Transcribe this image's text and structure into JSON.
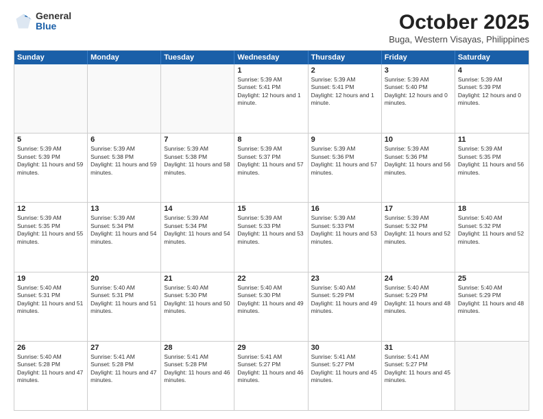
{
  "logo": {
    "general": "General",
    "blue": "Blue"
  },
  "title": "October 2025",
  "location": "Buga, Western Visayas, Philippines",
  "days_of_week": [
    "Sunday",
    "Monday",
    "Tuesday",
    "Wednesday",
    "Thursday",
    "Friday",
    "Saturday"
  ],
  "weeks": [
    [
      {
        "day": "",
        "sunrise": "",
        "sunset": "",
        "daylight": "",
        "empty": true
      },
      {
        "day": "",
        "sunrise": "",
        "sunset": "",
        "daylight": "",
        "empty": true
      },
      {
        "day": "",
        "sunrise": "",
        "sunset": "",
        "daylight": "",
        "empty": true
      },
      {
        "day": "1",
        "sunrise": "Sunrise: 5:39 AM",
        "sunset": "Sunset: 5:41 PM",
        "daylight": "Daylight: 12 hours and 1 minute."
      },
      {
        "day": "2",
        "sunrise": "Sunrise: 5:39 AM",
        "sunset": "Sunset: 5:41 PM",
        "daylight": "Daylight: 12 hours and 1 minute."
      },
      {
        "day": "3",
        "sunrise": "Sunrise: 5:39 AM",
        "sunset": "Sunset: 5:40 PM",
        "daylight": "Daylight: 12 hours and 0 minutes."
      },
      {
        "day": "4",
        "sunrise": "Sunrise: 5:39 AM",
        "sunset": "Sunset: 5:39 PM",
        "daylight": "Daylight: 12 hours and 0 minutes."
      }
    ],
    [
      {
        "day": "5",
        "sunrise": "Sunrise: 5:39 AM",
        "sunset": "Sunset: 5:39 PM",
        "daylight": "Daylight: 11 hours and 59 minutes."
      },
      {
        "day": "6",
        "sunrise": "Sunrise: 5:39 AM",
        "sunset": "Sunset: 5:38 PM",
        "daylight": "Daylight: 11 hours and 59 minutes."
      },
      {
        "day": "7",
        "sunrise": "Sunrise: 5:39 AM",
        "sunset": "Sunset: 5:38 PM",
        "daylight": "Daylight: 11 hours and 58 minutes."
      },
      {
        "day": "8",
        "sunrise": "Sunrise: 5:39 AM",
        "sunset": "Sunset: 5:37 PM",
        "daylight": "Daylight: 11 hours and 57 minutes."
      },
      {
        "day": "9",
        "sunrise": "Sunrise: 5:39 AM",
        "sunset": "Sunset: 5:36 PM",
        "daylight": "Daylight: 11 hours and 57 minutes."
      },
      {
        "day": "10",
        "sunrise": "Sunrise: 5:39 AM",
        "sunset": "Sunset: 5:36 PM",
        "daylight": "Daylight: 11 hours and 56 minutes."
      },
      {
        "day": "11",
        "sunrise": "Sunrise: 5:39 AM",
        "sunset": "Sunset: 5:35 PM",
        "daylight": "Daylight: 11 hours and 56 minutes."
      }
    ],
    [
      {
        "day": "12",
        "sunrise": "Sunrise: 5:39 AM",
        "sunset": "Sunset: 5:35 PM",
        "daylight": "Daylight: 11 hours and 55 minutes."
      },
      {
        "day": "13",
        "sunrise": "Sunrise: 5:39 AM",
        "sunset": "Sunset: 5:34 PM",
        "daylight": "Daylight: 11 hours and 54 minutes."
      },
      {
        "day": "14",
        "sunrise": "Sunrise: 5:39 AM",
        "sunset": "Sunset: 5:34 PM",
        "daylight": "Daylight: 11 hours and 54 minutes."
      },
      {
        "day": "15",
        "sunrise": "Sunrise: 5:39 AM",
        "sunset": "Sunset: 5:33 PM",
        "daylight": "Daylight: 11 hours and 53 minutes."
      },
      {
        "day": "16",
        "sunrise": "Sunrise: 5:39 AM",
        "sunset": "Sunset: 5:33 PM",
        "daylight": "Daylight: 11 hours and 53 minutes."
      },
      {
        "day": "17",
        "sunrise": "Sunrise: 5:39 AM",
        "sunset": "Sunset: 5:32 PM",
        "daylight": "Daylight: 11 hours and 52 minutes."
      },
      {
        "day": "18",
        "sunrise": "Sunrise: 5:40 AM",
        "sunset": "Sunset: 5:32 PM",
        "daylight": "Daylight: 11 hours and 52 minutes."
      }
    ],
    [
      {
        "day": "19",
        "sunrise": "Sunrise: 5:40 AM",
        "sunset": "Sunset: 5:31 PM",
        "daylight": "Daylight: 11 hours and 51 minutes."
      },
      {
        "day": "20",
        "sunrise": "Sunrise: 5:40 AM",
        "sunset": "Sunset: 5:31 PM",
        "daylight": "Daylight: 11 hours and 51 minutes."
      },
      {
        "day": "21",
        "sunrise": "Sunrise: 5:40 AM",
        "sunset": "Sunset: 5:30 PM",
        "daylight": "Daylight: 11 hours and 50 minutes."
      },
      {
        "day": "22",
        "sunrise": "Sunrise: 5:40 AM",
        "sunset": "Sunset: 5:30 PM",
        "daylight": "Daylight: 11 hours and 49 minutes."
      },
      {
        "day": "23",
        "sunrise": "Sunrise: 5:40 AM",
        "sunset": "Sunset: 5:29 PM",
        "daylight": "Daylight: 11 hours and 49 minutes."
      },
      {
        "day": "24",
        "sunrise": "Sunrise: 5:40 AM",
        "sunset": "Sunset: 5:29 PM",
        "daylight": "Daylight: 11 hours and 48 minutes."
      },
      {
        "day": "25",
        "sunrise": "Sunrise: 5:40 AM",
        "sunset": "Sunset: 5:29 PM",
        "daylight": "Daylight: 11 hours and 48 minutes."
      }
    ],
    [
      {
        "day": "26",
        "sunrise": "Sunrise: 5:40 AM",
        "sunset": "Sunset: 5:28 PM",
        "daylight": "Daylight: 11 hours and 47 minutes."
      },
      {
        "day": "27",
        "sunrise": "Sunrise: 5:41 AM",
        "sunset": "Sunset: 5:28 PM",
        "daylight": "Daylight: 11 hours and 47 minutes."
      },
      {
        "day": "28",
        "sunrise": "Sunrise: 5:41 AM",
        "sunset": "Sunset: 5:28 PM",
        "daylight": "Daylight: 11 hours and 46 minutes."
      },
      {
        "day": "29",
        "sunrise": "Sunrise: 5:41 AM",
        "sunset": "Sunset: 5:27 PM",
        "daylight": "Daylight: 11 hours and 46 minutes."
      },
      {
        "day": "30",
        "sunrise": "Sunrise: 5:41 AM",
        "sunset": "Sunset: 5:27 PM",
        "daylight": "Daylight: 11 hours and 45 minutes."
      },
      {
        "day": "31",
        "sunrise": "Sunrise: 5:41 AM",
        "sunset": "Sunset: 5:27 PM",
        "daylight": "Daylight: 11 hours and 45 minutes."
      },
      {
        "day": "",
        "sunrise": "",
        "sunset": "",
        "daylight": "",
        "empty": true
      }
    ]
  ]
}
